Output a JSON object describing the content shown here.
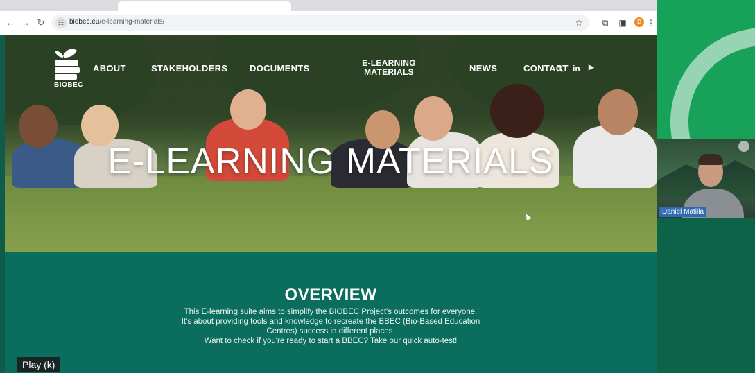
{
  "browser": {
    "url_host": "biobec.eu",
    "url_path": "/e-learning-materials/",
    "back_icon": "←",
    "forward_icon": "→",
    "reload_icon": "↻",
    "site_info_icon": "☷",
    "bookmark_icon": "☆",
    "extensions_icon": "⧉",
    "sidepanel_icon": "▣",
    "profile_initial": "D",
    "menu_icon": "⋮"
  },
  "site": {
    "logo_text": "BIOBEC",
    "nav": {
      "about": "ABOUT",
      "stakeholders": "STAKEHOLDERS",
      "documents": "DOCUMENTS",
      "elearning_line1": "E-LEARNING",
      "elearning_line2": "MATERIALS",
      "news": "NEWS",
      "contact": "CONTACT"
    },
    "social": {
      "twitter": "𝕏",
      "linkedin": "in",
      "youtube": "▶"
    },
    "hero_title": "E-LEARNING MATERIALS",
    "overview": {
      "title": "OVERVIEW",
      "line1": "This E-learning suite aims to simplify the BIOBEC Project's outcomes for everyone.",
      "line2": "It's about providing tools and knowledge to recreate the BBEC (Bio-Based Education",
      "line3": "Centres) success in different places.",
      "line4": "Want to check if you're ready to start a BBEC? Take our quick auto-test!"
    }
  },
  "call": {
    "participant_name": "Daniel Matilla"
  },
  "player": {
    "play_tooltip": "Play (k)"
  },
  "colors": {
    "overview_bg": "#0b6d5d",
    "side_top": "#18a158",
    "name_badge": "#2e6bb1"
  }
}
